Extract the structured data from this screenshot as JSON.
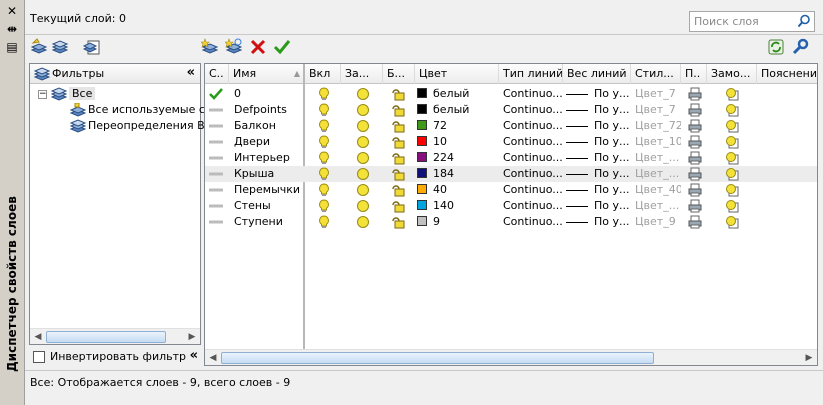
{
  "palette": {
    "title": "Диспетчер свойств слоев"
  },
  "header": {
    "current_layer": "Текущий слой: 0",
    "search_placeholder": "Поиск слоя"
  },
  "filters": {
    "title": "Фильтры",
    "tree": [
      {
        "label": "Все",
        "level": 0,
        "selected": true
      },
      {
        "label": "Все используемые сл",
        "level": 1,
        "selected": false
      },
      {
        "label": "Переопределения ВЗ",
        "level": 1,
        "selected": false
      }
    ],
    "invert_label": "Инвертировать фильтр"
  },
  "grid": {
    "headers": [
      "С..",
      "Имя",
      "Вкл",
      "За...",
      "Б...",
      "Цвет",
      "Тип линий",
      "Вес линий",
      "Стил...",
      "П..",
      "Замо...",
      "Пояснение"
    ],
    "rows": [
      {
        "current": true,
        "name": "0",
        "color_name": "белый",
        "color_hex": "#000000",
        "linetype": "Continuo...",
        "lineweight": "По у...",
        "style": "Цвет_7",
        "selected": false
      },
      {
        "current": false,
        "name": "Defpoints",
        "color_name": "белый",
        "color_hex": "#000000",
        "linetype": "Continuo...",
        "lineweight": "По у...",
        "style": "Цвет_7",
        "selected": false
      },
      {
        "current": false,
        "name": "Балкон",
        "color_name": "72",
        "color_hex": "#3c9a16",
        "linetype": "Continuo...",
        "lineweight": "По у...",
        "style": "Цвет_72",
        "selected": false
      },
      {
        "current": false,
        "name": "Двери",
        "color_name": "10",
        "color_hex": "#ff0000",
        "linetype": "Continuo...",
        "lineweight": "По у...",
        "style": "Цвет_10",
        "selected": false
      },
      {
        "current": false,
        "name": "Интерьер",
        "color_name": "224",
        "color_hex": "#8a0f7e",
        "linetype": "Continuo...",
        "lineweight": "По у...",
        "style": "Цвет_...",
        "selected": false
      },
      {
        "current": false,
        "name": "Крыша",
        "color_name": "184",
        "color_hex": "#10107a",
        "linetype": "Continuo...",
        "lineweight": "По у...",
        "style": "Цвет_...",
        "selected": true
      },
      {
        "current": false,
        "name": "Перемычки",
        "color_name": "40",
        "color_hex": "#ffaa00",
        "linetype": "Continuo...",
        "lineweight": "По у...",
        "style": "Цвет_40",
        "selected": false
      },
      {
        "current": false,
        "name": "Стены",
        "color_name": "140",
        "color_hex": "#00a5e0",
        "linetype": "Continuo...",
        "lineweight": "По у...",
        "style": "Цвет_...",
        "selected": false
      },
      {
        "current": false,
        "name": "Ступени",
        "color_name": "9",
        "color_hex": "#c0c0c0",
        "linetype": "Continuo...",
        "lineweight": "По у...",
        "style": "Цвет_9",
        "selected": false
      }
    ]
  },
  "status": "Все: Отображается слоев - 9, всего слоев - 9",
  "colors": {
    "current_check": "#2a9a1a",
    "delete_x": "#d01010",
    "bulb": "#f3e13a",
    "sun": "#f2e23a"
  }
}
